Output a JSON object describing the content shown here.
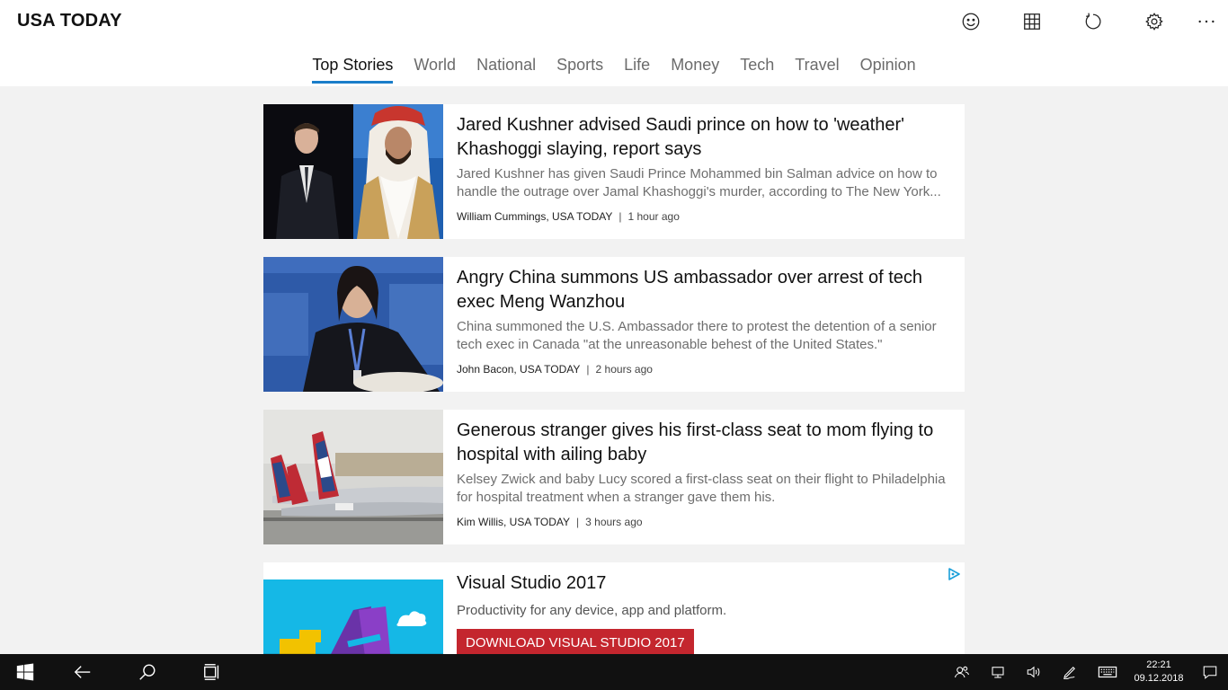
{
  "app": {
    "title": "USA TODAY"
  },
  "header_icons": [
    "smiley-icon",
    "grid-icon",
    "refresh-icon",
    "settings-icon",
    "more-icon"
  ],
  "tabs": [
    {
      "label": "Top Stories",
      "active": true
    },
    {
      "label": "World"
    },
    {
      "label": "National"
    },
    {
      "label": "Sports"
    },
    {
      "label": "Life"
    },
    {
      "label": "Money"
    },
    {
      "label": "Tech"
    },
    {
      "label": "Travel"
    },
    {
      "label": "Opinion"
    }
  ],
  "stories": [
    {
      "headline": "Jared Kushner advised Saudi prince on how to 'weather' Khashoggi slaying, report says",
      "summary": "Jared Kushner has given Saudi Prince Mohammed bin Salman advice on how to handle the outrage over  Jamal Khashoggi's murder, according to The New York...",
      "author": "William Cummings, USA TODAY",
      "time": "1 hour ago"
    },
    {
      "headline": "Angry China summons US ambassador over arrest of tech exec Meng Wanzhou",
      "summary": "China summoned the U.S. Ambassador there to protest the detention of a senior tech exec in Canada \"at the unreasonable behest of the United States.\"",
      "author": "John Bacon, USA TODAY",
      "time": "2 hours ago"
    },
    {
      "headline": "Generous stranger gives his first-class seat to mom flying to hospital with ailing baby",
      "summary": "Kelsey Zwick and baby Lucy scored a first-class seat on their flight to Philadelphia for hospital treatment when a stranger gave them his.",
      "author": "Kim Willis, USA TODAY",
      "time": "3 hours ago"
    }
  ],
  "meta_separator": "|",
  "ad": {
    "title": "Visual Studio 2017",
    "description": "Productivity for any device, app and platform.",
    "button": "DOWNLOAD VISUAL STUDIO 2017"
  },
  "taskbar": {
    "time": "22:21",
    "date": "09.12.2018"
  },
  "colors": {
    "accent": "#1a7dc9",
    "ad_button": "#c4262e",
    "page_bg": "#f2f2f2",
    "taskbar": "#111111"
  }
}
